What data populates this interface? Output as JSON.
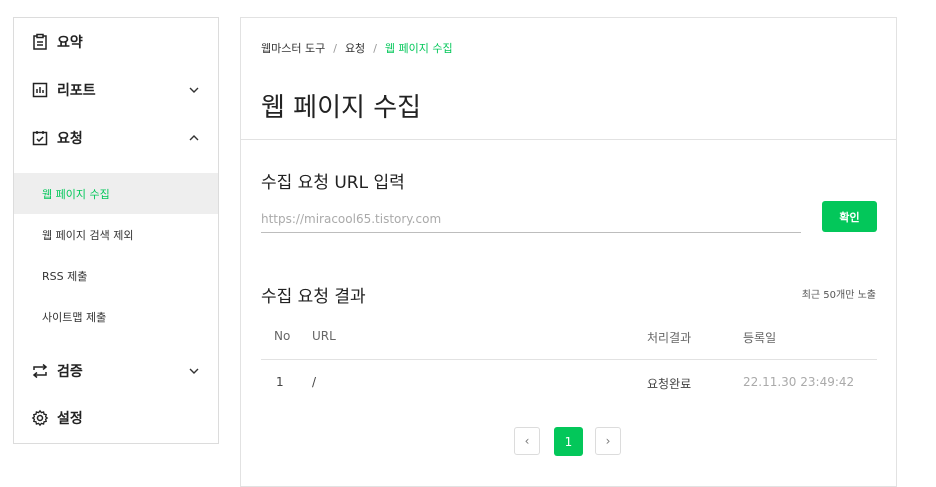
{
  "sidebar": {
    "summary": "요약",
    "report": "리포트",
    "request": "요청",
    "request_items": [
      "웹 페이지 수집",
      "웹 페이지 검색 제외",
      "RSS 제출",
      "사이트맵 제출"
    ],
    "verify": "검증",
    "settings": "설정"
  },
  "breadcrumb": {
    "root": "웹마스터 도구",
    "sep1": "/",
    "parent": "요청",
    "sep2": "/",
    "current": "웹 페이지 수집"
  },
  "page_title": "웹 페이지 수집",
  "request_section": {
    "title": "수집 요청 URL 입력",
    "placeholder": "https://miracool65.tistory.com",
    "button": "확인"
  },
  "result_section": {
    "title": "수집 요청 결과",
    "note": "최근 50개만 노출",
    "columns": [
      "No",
      "URL",
      "처리결과",
      "등록일"
    ],
    "rows": [
      {
        "no": "1",
        "url": "/",
        "status": "요청완료",
        "date": "22.11.30 23:49:42"
      }
    ]
  },
  "pagination": {
    "prev": "‹",
    "current": "1",
    "next": "›"
  },
  "colors": {
    "accent": "#03c75a",
    "active_bg": "#eeeeee"
  },
  "icons": [
    "summary-icon",
    "report-icon",
    "request-icon",
    "verify-icon",
    "settings-icon",
    "chevron-down-icon",
    "chevron-up-icon"
  ]
}
